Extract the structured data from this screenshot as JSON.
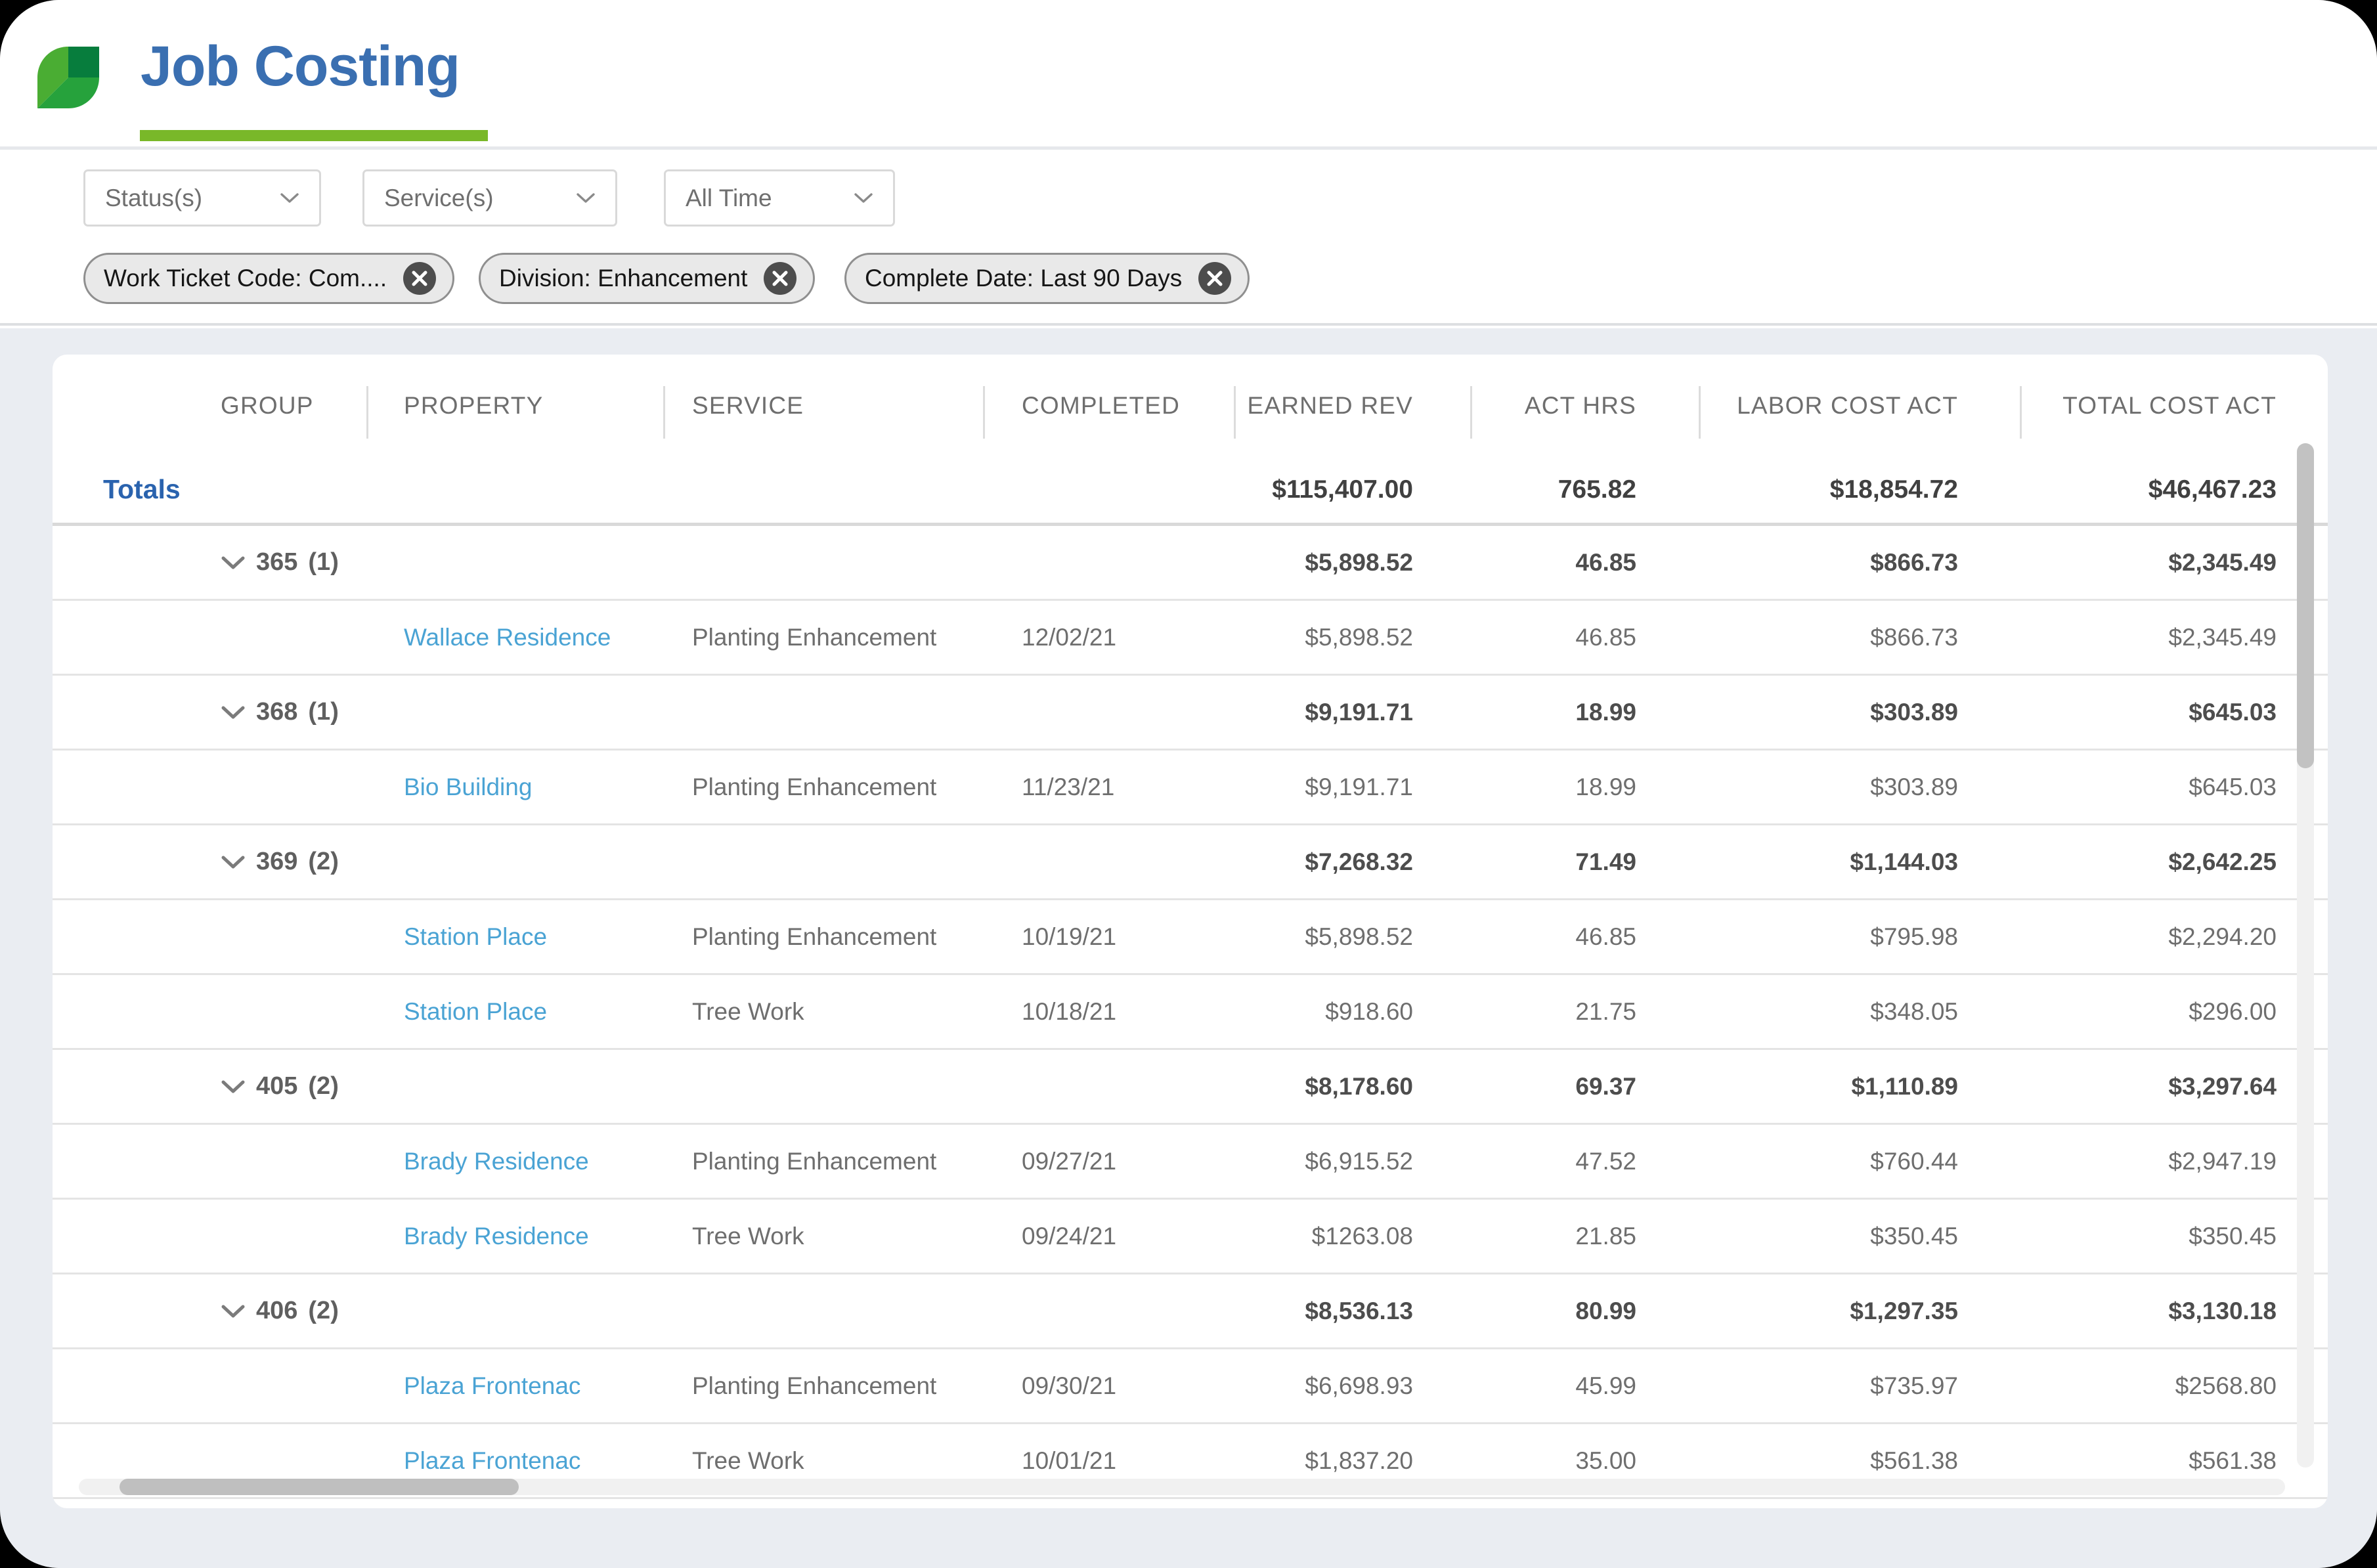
{
  "page": {
    "title": "Job Costing"
  },
  "colors": {
    "title_blue": "#3a6fb1",
    "brand_green": "#79b829",
    "logo_light_green": "#4aad33",
    "logo_dark_green": "#077d3d",
    "logo_mid_green": "#26a23c",
    "link_blue": "#4aa3d4",
    "totals_blue": "#2a63ae"
  },
  "filters": {
    "dropdowns": [
      {
        "label": "Status(s)"
      },
      {
        "label": "Service(s)"
      },
      {
        "label": "All Time"
      }
    ],
    "chips": [
      {
        "label": "Work Ticket Code: Com...."
      },
      {
        "label": "Division: Enhancement"
      },
      {
        "label": "Complete Date: Last 90 Days"
      }
    ]
  },
  "table": {
    "columns": [
      {
        "key": "group",
        "label": "GROUP"
      },
      {
        "key": "property",
        "label": "PROPERTY"
      },
      {
        "key": "service",
        "label": "SERVICE"
      },
      {
        "key": "completed",
        "label": "COMPLETED"
      },
      {
        "key": "earned_rev",
        "label": "EARNED REV"
      },
      {
        "key": "act_hrs",
        "label": "ACT HRS"
      },
      {
        "key": "labor_cost_act",
        "label": "LABOR COST ACT"
      },
      {
        "key": "total_cost_act",
        "label": "TOTAL COST ACT"
      }
    ],
    "totals": {
      "label": "Totals",
      "earned_rev": "$115,407.00",
      "act_hrs": "765.82",
      "labor_cost_act": "$18,854.72",
      "total_cost_act": "$46,467.23"
    },
    "rows": [
      {
        "type": "group",
        "group": "365",
        "count": "(1)",
        "earned_rev": "$5,898.52",
        "act_hrs": "46.85",
        "labor_cost_act": "$866.73",
        "total_cost_act": "$2,345.49"
      },
      {
        "type": "detail",
        "property": "Wallace Residence",
        "service": "Planting Enhancement",
        "completed": "12/02/21",
        "earned_rev": "$5,898.52",
        "act_hrs": "46.85",
        "labor_cost_act": "$866.73",
        "total_cost_act": "$2,345.49"
      },
      {
        "type": "group",
        "group": "368",
        "count": "(1)",
        "earned_rev": "$9,191.71",
        "act_hrs": "18.99",
        "labor_cost_act": "$303.89",
        "total_cost_act": "$645.03"
      },
      {
        "type": "detail",
        "property": "Bio Building",
        "service": "Planting Enhancement",
        "completed": "11/23/21",
        "earned_rev": "$9,191.71",
        "act_hrs": "18.99",
        "labor_cost_act": "$303.89",
        "total_cost_act": "$645.03"
      },
      {
        "type": "group",
        "group": "369",
        "count": "(2)",
        "earned_rev": "$7,268.32",
        "act_hrs": "71.49",
        "labor_cost_act": "$1,144.03",
        "total_cost_act": "$2,642.25"
      },
      {
        "type": "detail",
        "property": "Station Place",
        "service": "Planting Enhancement",
        "completed": "10/19/21",
        "earned_rev": "$5,898.52",
        "act_hrs": "46.85",
        "labor_cost_act": "$795.98",
        "total_cost_act": "$2,294.20"
      },
      {
        "type": "detail",
        "property": "Station Place",
        "service": "Tree Work",
        "completed": "10/18/21",
        "earned_rev": "$918.60",
        "act_hrs": "21.75",
        "labor_cost_act": "$348.05",
        "total_cost_act": "$296.00"
      },
      {
        "type": "group",
        "group": "405",
        "count": "(2)",
        "earned_rev": "$8,178.60",
        "act_hrs": "69.37",
        "labor_cost_act": "$1,110.89",
        "total_cost_act": "$3,297.64"
      },
      {
        "type": "detail",
        "property": "Brady Residence",
        "service": "Planting Enhancement",
        "completed": "09/27/21",
        "earned_rev": "$6,915.52",
        "act_hrs": "47.52",
        "labor_cost_act": "$760.44",
        "total_cost_act": "$2,947.19"
      },
      {
        "type": "detail",
        "property": "Brady Residence",
        "service": "Tree Work",
        "completed": "09/24/21",
        "earned_rev": "$1263.08",
        "act_hrs": "21.85",
        "labor_cost_act": "$350.45",
        "total_cost_act": "$350.45"
      },
      {
        "type": "group",
        "group": "406",
        "count": "(2)",
        "earned_rev": "$8,536.13",
        "act_hrs": "80.99",
        "labor_cost_act": "$1,297.35",
        "total_cost_act": "$3,130.18"
      },
      {
        "type": "detail",
        "property": "Plaza Frontenac",
        "service": "Planting Enhancement",
        "completed": "09/30/21",
        "earned_rev": "$6,698.93",
        "act_hrs": "45.99",
        "labor_cost_act": "$735.97",
        "total_cost_act": "$2568.80"
      },
      {
        "type": "detail",
        "property": "Plaza Frontenac",
        "service": "Tree Work",
        "completed": "10/01/21",
        "earned_rev": "$1,837.20",
        "act_hrs": "35.00",
        "labor_cost_act": "$561.38",
        "total_cost_act": "$561.38"
      }
    ]
  }
}
